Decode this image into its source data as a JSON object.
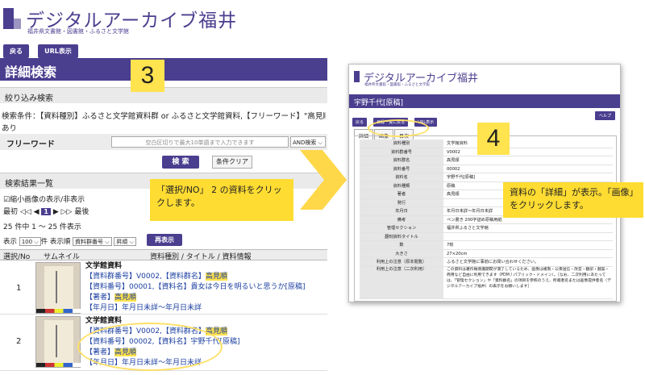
{
  "left": {
    "logo_title": "デジタルアーカイブ福井",
    "logo_sub": "福井県文書館・図書館・ふるさと文学館",
    "btn_back": "戻る",
    "btn_url": "URL表示",
    "page_title": "詳細検索",
    "refine_header": "絞り込み検索",
    "condition_line1": "検索条件：【資料種別】ふるさと文学館資料群 or ふるさと文学館資料,【フリーワード】\"高見順\",【",
    "condition_line2": "あり",
    "freeword_label": "フリーワード",
    "freeword_placeholder": "空白区切りで最大10単語まで入力できます",
    "freeword_mode": "AND検索",
    "search_btn": "検 索",
    "clear_btn": "条件クリア",
    "results_header": "検索結果一覧",
    "thumb_toggle": "☑縮小画像の表示/非表示",
    "pager_first": "最初",
    "pager_prev": "◁◁ ◀",
    "pager_current": "1",
    "pager_next": "▶ ▷▷",
    "pager_last": "最後",
    "count_text": "25 件中 1 ～ 25 件表示",
    "disp_label": "表示",
    "disp_count": "100",
    "disp_unit": "件 表示順",
    "sort_field": "資料群番号",
    "sort_dir": "昇順",
    "redisplay_btn": "再表示",
    "col_no": "選択/No",
    "col_thumb": "サムネイル",
    "col_info": "資料種別 / タイトル / 資料情報",
    "rows": [
      {
        "no": "1",
        "type": "文学館資料",
        "line1_pre": "【資料群番号】V0002,【資料群名】",
        "line1_hl": "高見順",
        "line2": "【資料番号】00001,【資料名】貴女は今日を明るいと思うか[原稿]",
        "line3_pre": "【著者】",
        "line3_hl": "高見順",
        "line4": "【年月日】年月日未詳～年月日未詳"
      },
      {
        "no": "2",
        "type": "文学館資料",
        "line1_pre": "【資料群番号】V0002,【資料群名】",
        "line1_hl": "高見順",
        "line2": "【資料番号】00002,【資料名】宇野千代[原稿]",
        "line3_pre": "【著者】",
        "line3_hl": "高見順",
        "line4": "【年月日】年月日未詳～年月日未詳"
      }
    ],
    "step_number": "3",
    "callout_text": "「選択/NO」 2 の資料をクリックします。"
  },
  "right": {
    "logo_title": "デジタルアーカイブ福井",
    "logo_sub": "福井県文書館・図書館・ふるさと文学館",
    "title_bar": "宇野千代[原稿]",
    "btn_back": "戻る",
    "btn_list": "目録一覧に戻る",
    "btn_url": "URL表示",
    "btn_help": "ヘルプ",
    "tabs": [
      "詳細",
      "画像",
      "目次"
    ],
    "fields": [
      {
        "k": "資料種別",
        "v": "文学館資料"
      },
      {
        "k": "資料群番号",
        "v": "V0002"
      },
      {
        "k": "資料群名",
        "v": "高見順"
      },
      {
        "k": "資料番号",
        "v": "00002"
      },
      {
        "k": "資料名",
        "v": "宇野千代[原稿]"
      },
      {
        "k": "資料種類",
        "v": "原稿"
      },
      {
        "k": "著者",
        "v": "高見順"
      },
      {
        "k": "発行",
        "v": ""
      },
      {
        "k": "年月日",
        "v": "年月日未詳～年月日未詳"
      },
      {
        "k": "備考",
        "v": "ペン書き 200字詰め原稿用紙"
      },
      {
        "k": "管理セクション",
        "v": "福井県ふるさと文学館"
      },
      {
        "k": "翻刻資料タイトル",
        "v": ""
      },
      {
        "k": "数",
        "v": "7枚"
      },
      {
        "k": "大きさ",
        "v": "27×20cm"
      },
      {
        "k": "利用上の注意（原本閲覧）",
        "v": "ふるさと文学館に事前にお問い合わせください。"
      }
    ],
    "notice_key": "利用上の注意（二次利用）",
    "notice_val": "この資料は著作権保護期間が満了しているため、画像は複製・公衆送信・改変・翻訳・翻案・商用など自由に利用できます（PDM / パブリック・ドメイン）。［なお、二次利用にあたっては、「管理セクション」や「資料群名」の項目を参照のうえ、所蔵者名または画像提供者名（デジタルアーカイブ福井）の表示をお願いします］",
    "step_number": "4",
    "callout_text": "資料の「詳細」が表示。「画像」をクリックします。"
  },
  "colors": {
    "brand": "#4a3e8f",
    "highlight": "#ffe24d",
    "callout": "#ffdc32"
  }
}
